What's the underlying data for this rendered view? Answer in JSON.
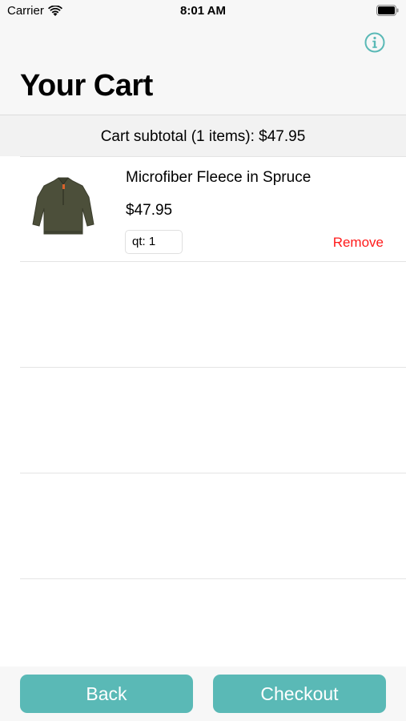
{
  "status_bar": {
    "carrier": "Carrier",
    "time": "8:01 AM"
  },
  "header": {
    "title": "Your Cart",
    "info_icon": "info-circle-icon"
  },
  "cart": {
    "subtotal_text": "Cart subtotal (1 items): $47.95",
    "items": [
      {
        "name": "Microfiber Fleece in Spruce",
        "price": "$47.95",
        "quantity_text": "qt: 1",
        "remove_label": "Remove"
      }
    ],
    "empty_rows": 3
  },
  "footer": {
    "back_label": "Back",
    "checkout_label": "Checkout"
  },
  "colors": {
    "accent": "#5ab9b6",
    "destructive": "#ff1a1a",
    "bar_background": "#f7f7f7"
  }
}
